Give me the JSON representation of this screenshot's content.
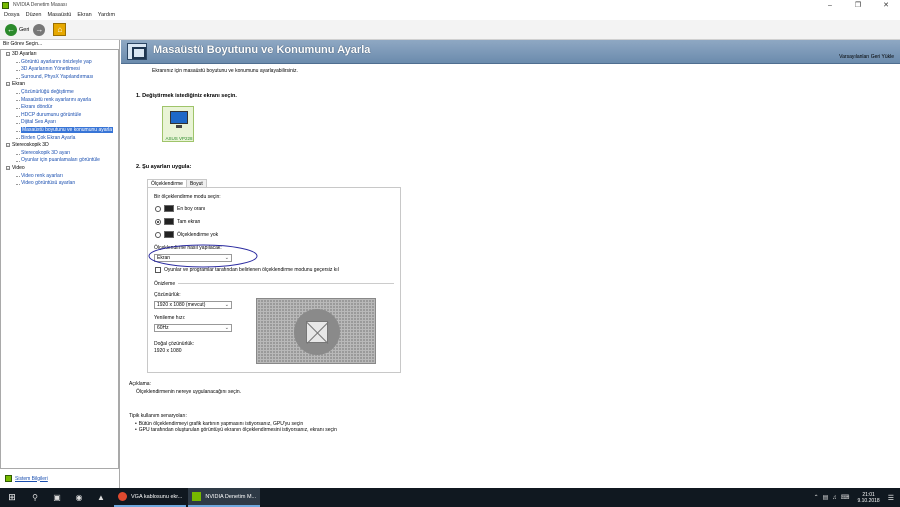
{
  "window": {
    "title": "NVIDIA Denetim Masası"
  },
  "menu": [
    "Dosya",
    "Düzen",
    "Masaüstü",
    "Ekran",
    "Yardım"
  ],
  "toolbar": {
    "back_label": "Geri"
  },
  "sidebar": {
    "header": "Bir Görev Seçin...",
    "tree": [
      {
        "label": "3D Ayarları",
        "type": "cat"
      },
      {
        "label": "Görüntü ayarlarını önizleyle yap",
        "type": "child"
      },
      {
        "label": "3D Ayarlarının Yönetilmesi",
        "type": "child"
      },
      {
        "label": "Surround, PhysX Yapılandırması",
        "type": "child"
      },
      {
        "label": "Ekran",
        "type": "cat"
      },
      {
        "label": "Çözünürlüğü değiştirme",
        "type": "child"
      },
      {
        "label": "Masaüstü renk ayarlarını ayarla",
        "type": "child"
      },
      {
        "label": "Ekranı döndür",
        "type": "child"
      },
      {
        "label": "HDCP durumunu görüntüle",
        "type": "child"
      },
      {
        "label": "Dijital Ses Ayarı",
        "type": "child"
      },
      {
        "label": "Masaüstü boyutunu ve konumunu ayarla",
        "type": "child",
        "selected": true
      },
      {
        "label": "Birden Çok Ekran Ayarla",
        "type": "child"
      },
      {
        "label": "Stereoskopik 3D",
        "type": "cat"
      },
      {
        "label": "Stereoskopik 3D ayarı",
        "type": "child"
      },
      {
        "label": "Oyunlar için puanlamaları görüntüle",
        "type": "child"
      },
      {
        "label": "Video",
        "type": "cat"
      },
      {
        "label": "Video renk ayarları",
        "type": "child"
      },
      {
        "label": "Video görüntüsü ayarları",
        "type": "child"
      }
    ],
    "system_info": "Sistem Bilgileri"
  },
  "page": {
    "title": "Masaüstü Boyutunu ve Konumunu Ayarla",
    "restore_defaults": "Varsayılanları Geri Yükle",
    "description": "Ekranınız için masaüstü boyutunu ve konumunu ayarlayabilirsiniz.",
    "step1": "1. Değiştirmek istediğiniz ekranı seçin.",
    "monitor_label": "ASUS VP228",
    "step2": "2. Şu ayarları uygula:",
    "tabs": [
      "Ölçeklendirme",
      "Boyut"
    ],
    "scaling_mode_label": "Bir ölçeklendirme modu seçin:",
    "modes": [
      "En boy oranı",
      "Tam ekran",
      "Ölçeklendirme yok"
    ],
    "selected_mode_index": 1,
    "perform_label": "Ölçeklendirme nasıl yapılacak:",
    "perform_value": "Ekran",
    "override_checkbox": "Oyunlar ve programlar tarafından belirlenen ölçeklendirme modunu geçersiz kıl",
    "override_checked": false,
    "preview_label": "Önizleme",
    "resolution_label": "Çözünürlük:",
    "resolution_value": "1920 x 1080 (mevcut)",
    "refresh_label": "Yenileme hızı:",
    "refresh_value": "60Hz",
    "native_label": "Doğal çözünürlük:",
    "native_value": "1920 x 1080",
    "explanation_title": "Açıklama:",
    "explanation_text": "Ölçeklendirmenin nereye uygulanacağını seçin.",
    "usage_title": "Tipik kullanım senaryoları:",
    "usage_items": [
      "Bütün ölçeklendirmeyi grafik kartının yapmasını istiyorsanız, GPU'yu seçin",
      "GPU tarafından oluşturulan görüntüyü ekranın ölçeklendirmesini istiyorsanız, ekranı seçin"
    ]
  },
  "taskbar": {
    "apps": [
      {
        "label": "VGA kablosunu ekr...",
        "color": "#e04a2f"
      },
      {
        "label": "NVIDIA Denetim M...",
        "color": "#76b900"
      }
    ],
    "time": "21:01",
    "date": "9.10.2018"
  },
  "colors": {
    "banner": "#7a97b8",
    "accent_green": "#76b900",
    "selection": "#3875d7",
    "annotation": "#2a2aa0"
  }
}
